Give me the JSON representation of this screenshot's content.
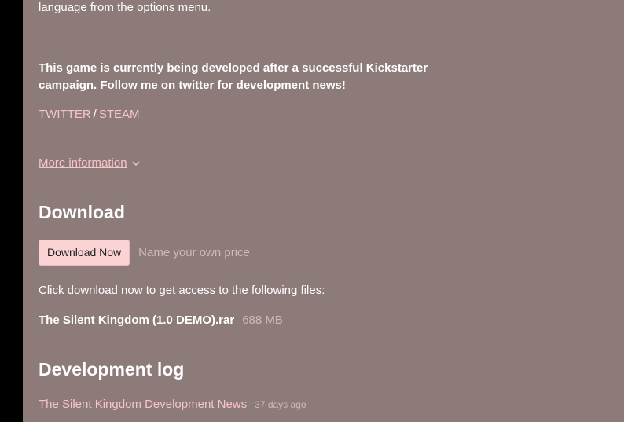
{
  "description": {
    "intro_tail": "language from the options menu.",
    "kickstarter_note": "This game is currently being developed after a successful Kickstarter campaign. Follow me on twitter for development news!",
    "links": [
      {
        "label": "TWITTER"
      },
      {
        "label": "STEAM"
      }
    ],
    "separator": "/",
    "more_info_label": "More information"
  },
  "download": {
    "title": "Download",
    "button_label": "Download Now",
    "price_note": "Name your own price",
    "files_intro": "Click download now to get access to the following files:",
    "files": [
      {
        "name": "The Silent Kingdom (1.0 DEMO).rar",
        "size": "688 MB"
      }
    ]
  },
  "devlog": {
    "title": "Development log",
    "posts": [
      {
        "title": "The Silent Kingdom Development News",
        "date": "37 days ago"
      }
    ]
  },
  "colors": {
    "background": "#8d7b7a",
    "sidebar": "#000000",
    "link": "#f7c5c7",
    "button_bg": "#fbd3d4",
    "muted_text": "#cdbcbb"
  },
  "icons": {
    "more_info": "chevron-down-icon"
  }
}
